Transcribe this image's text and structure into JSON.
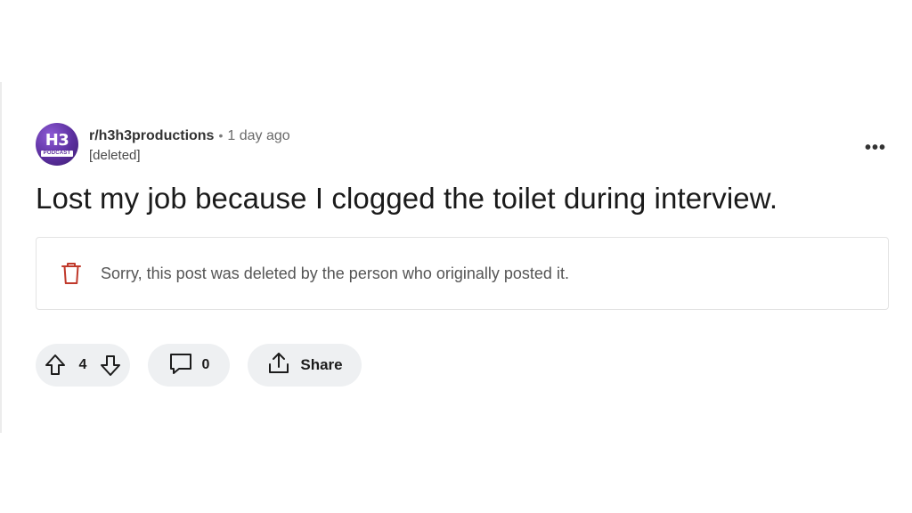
{
  "post": {
    "subreddit": "r/h3h3productions",
    "separator": "•",
    "time_ago": "1 day ago",
    "author": "[deleted]",
    "avatar": {
      "main_text": "H3",
      "sub_text": "PODCAST",
      "color": "#5b2f9e"
    },
    "more_label": "•••",
    "title": "Lost my job because I clogged the toilet during interview.",
    "deleted_notice": "Sorry, this post was deleted by the person who originally posted it.",
    "trash_icon_color": "#c0392b"
  },
  "actions": {
    "upvote_icon": "arrow-up-icon",
    "vote_count": "4",
    "downvote_icon": "arrow-down-icon",
    "comment_icon": "comment-bubble-icon",
    "comment_count": "0",
    "share_icon": "share-icon",
    "share_label": "Share"
  }
}
